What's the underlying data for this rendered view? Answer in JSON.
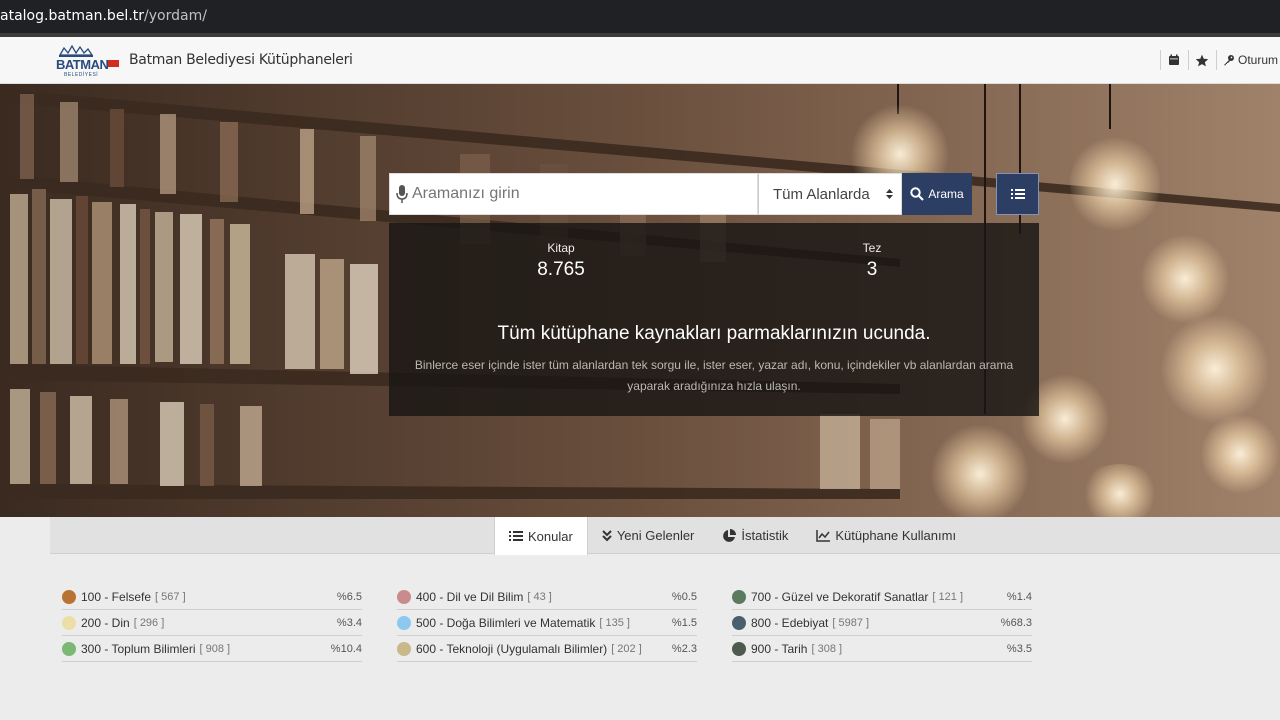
{
  "browser": {
    "url_host": "atalog.batman.bel.tr",
    "url_path": "/yordam/"
  },
  "header": {
    "title": "Batman Belediyesi Kütüphaneleri",
    "logo_text": "BATMAN",
    "logo_sub": "BELEDİYESİ",
    "login_label": "Oturum",
    "icons": [
      "calendar-icon",
      "star-icon",
      "key-icon"
    ]
  },
  "search": {
    "placeholder": "Aramanızı girin",
    "scope_selected": "Tüm Alanlarda",
    "button_label": "Arama"
  },
  "stats": [
    {
      "label": "Kitap",
      "value": "8.765"
    },
    {
      "label": "Tez",
      "value": "3"
    }
  ],
  "hero": {
    "tagline": "Tüm kütüphane kaynakları parmaklarınızın ucunda.",
    "subtext": "Binlerce eser içinde ister tüm alanlardan tek sorgu ile, ister eser, yazar adı, konu, içindekiler vb alanlardan arama yaparak aradığınıza hızla ulaşın."
  },
  "tabs": [
    {
      "label": "Konular",
      "icon": "list-icon",
      "active": true
    },
    {
      "label": "Yeni Gelenler",
      "icon": "double-chevron-down-icon",
      "active": false
    },
    {
      "label": "İstatistik",
      "icon": "pie-chart-icon",
      "active": false
    },
    {
      "label": "Kütüphane Kullanımı",
      "icon": "line-chart-icon",
      "active": false
    }
  ],
  "subjects": [
    {
      "name": "100 - Felsefe",
      "count": "[ 567 ]",
      "pct": "%6.5",
      "color": "#b87333"
    },
    {
      "name": "400 - Dil ve Dil Bilim",
      "count": "[ 43 ]",
      "pct": "%0.5",
      "color": "#c98b8b"
    },
    {
      "name": "700 - Güzel ve Dekoratif Sanatlar",
      "count": "[ 121 ]",
      "pct": "%1.4",
      "color": "#5b7a5f"
    },
    {
      "name": "200 - Din",
      "count": "[ 296 ]",
      "pct": "%3.4",
      "color": "#ecdfa6"
    },
    {
      "name": "500 - Doğa Bilimleri ve Matematik",
      "count": "[ 135 ]",
      "pct": "%1.5",
      "color": "#8cc8f0"
    },
    {
      "name": "800 - Edebiyat",
      "count": "[ 5987 ]",
      "pct": "%68.3",
      "color": "#4a5f6e"
    },
    {
      "name": "300 - Toplum Bilimleri",
      "count": "[ 908 ]",
      "pct": "%10.4",
      "color": "#7ab873"
    },
    {
      "name": "600 - Teknoloji (Uygulamalı Bilimler)",
      "count": "[ 202 ]",
      "pct": "%2.3",
      "color": "#c9b88a"
    },
    {
      "name": "900 - Tarih",
      "count": "[ 308 ]",
      "pct": "%3.5",
      "color": "#4f5a4e"
    }
  ]
}
